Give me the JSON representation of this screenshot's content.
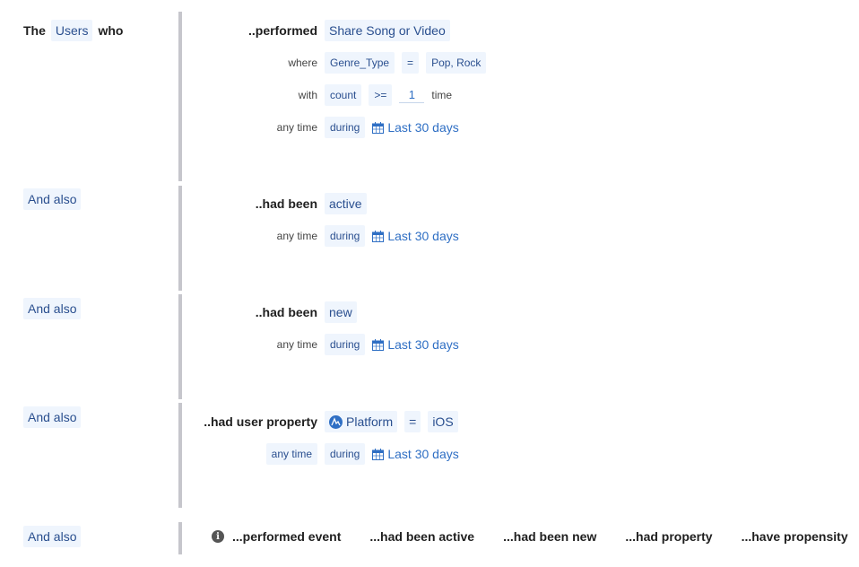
{
  "header": {
    "the": "The",
    "subject": "Users",
    "who": "who"
  },
  "blocks": [
    {
      "verb": "..performed",
      "event": "Share Song or Video",
      "where_label": "where",
      "property": "Genre_Type",
      "operator": "=",
      "value": "Pop, Rock",
      "with_label": "with",
      "metric": "count",
      "compare": ">=",
      "count": "1",
      "unit": "time",
      "time_label": "any time",
      "during": "during",
      "range": "Last 30 days"
    },
    {
      "conjunction": "And also",
      "verb": "..had been",
      "state": "active",
      "time_label": "any time",
      "during": "during",
      "range": "Last 30 days"
    },
    {
      "conjunction": "And also",
      "verb": "..had been",
      "state": "new",
      "time_label": "any time",
      "during": "during",
      "range": "Last 30 days"
    },
    {
      "conjunction": "And also",
      "verb": "..had user property",
      "property": "Platform",
      "operator": "=",
      "value": "iOS",
      "time_label": "any time",
      "during": "during",
      "range": "Last 30 days"
    }
  ],
  "add_row": {
    "conjunction": "And also",
    "options": [
      "...performed event",
      "...had been active",
      "...had been new",
      "...had property",
      "...have propensity"
    ]
  },
  "colors": {
    "accent": "#2f6fc4",
    "chip_bg": "#eff5fd",
    "bar": "#c6c6cc"
  }
}
